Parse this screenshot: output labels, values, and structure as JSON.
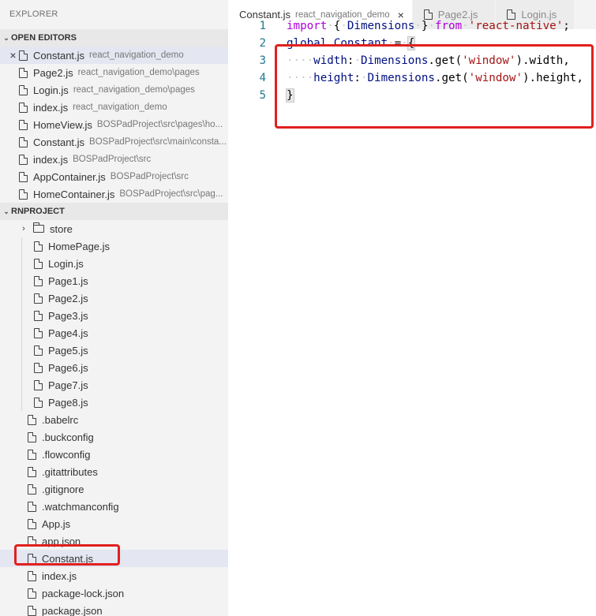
{
  "sidebar": {
    "title": "EXPLORER",
    "open_editors": {
      "header": "OPEN EDITORS",
      "items": [
        {
          "name": "Constant.js",
          "path": "react_navigation_demo",
          "active": true
        },
        {
          "name": "Page2.js",
          "path": "react_navigation_demo\\pages",
          "active": false
        },
        {
          "name": "Login.js",
          "path": "react_navigation_demo\\pages",
          "active": false
        },
        {
          "name": "index.js",
          "path": "react_navigation_demo",
          "active": false
        },
        {
          "name": "HomeView.js",
          "path": "BOSPadProject\\src\\pages\\ho...",
          "active": false
        },
        {
          "name": "Constant.js",
          "path": "BOSPadProject\\src\\main\\consta...",
          "active": false
        },
        {
          "name": "index.js",
          "path": "BOSPadProject\\src",
          "active": false
        },
        {
          "name": "AppContainer.js",
          "path": "BOSPadProject\\src",
          "active": false
        },
        {
          "name": "HomeContainer.js",
          "path": "BOSPadProject\\src\\pag...",
          "active": false
        }
      ]
    },
    "project": {
      "header": "RNPROJECT",
      "folder": "store",
      "nested_files": [
        "HomePage.js",
        "Login.js",
        "Page1.js",
        "Page2.js",
        "Page3.js",
        "Page4.js",
        "Page5.js",
        "Page6.js",
        "Page7.js",
        "Page8.js"
      ],
      "root_files": [
        ".babelrc",
        ".buckconfig",
        ".flowconfig",
        ".gitattributes",
        ".gitignore",
        ".watchmanconfig",
        "App.js",
        "app.json",
        "Constant.js",
        "index.js",
        "package-lock.json",
        "package.json"
      ],
      "selected_file": "Constant.js"
    }
  },
  "tabs": [
    {
      "label": "Constant.js",
      "desc": "react_navigation_demo",
      "active": true,
      "close": "×"
    },
    {
      "label": "Page2.js",
      "desc": "",
      "active": false
    },
    {
      "label": "Login.js",
      "desc": "",
      "active": false
    }
  ],
  "icons": {
    "close": "×",
    "chevron_down": "⌄",
    "chevron_right": "›"
  },
  "code": {
    "line_numbers": [
      "1",
      "2",
      "3",
      "4",
      "5"
    ],
    "line1": {
      "kw_import": "import",
      "open": "{",
      "ident": "Dimensions",
      "close": "}",
      "kw_from": "from",
      "module": "'react-native'",
      "semi": ";"
    },
    "line2": {
      "global": "global",
      "dot": ".",
      "prop": "Constant",
      "eq": "=",
      "open": "{"
    },
    "line3": {
      "key": "width",
      "colon": ":",
      "obj": "Dimensions",
      "call": ".get(",
      "arg": "'window'",
      "tail": ").width,"
    },
    "line4": {
      "key": "height",
      "colon": ":",
      "obj": "Dimensions",
      "call": ".get(",
      "arg": "'window'",
      "tail": ").height,"
    },
    "line5": {
      "close": "}"
    }
  },
  "colors": {
    "highlight": "#e0201e",
    "keyword": "#af00db",
    "string": "#a31515",
    "line_number": "#237893"
  }
}
